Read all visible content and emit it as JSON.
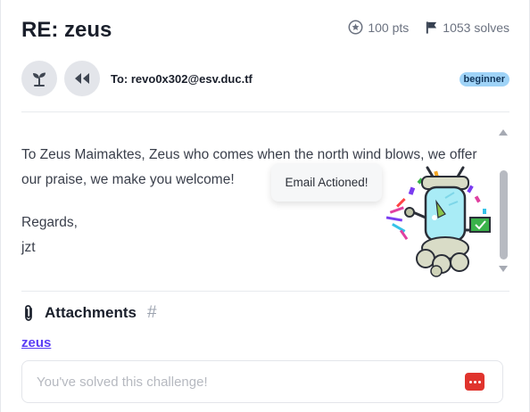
{
  "challenge": {
    "title": "RE: zeus",
    "points": "100 pts",
    "solves": "1053 solves",
    "to_line": "To: revo0x302@esv.duc.tf",
    "difficulty": "beginner"
  },
  "message": {
    "paragraph": "To Zeus Maimaktes, Zeus who comes when the north wind blows, we offer our praise, we make you welcome!",
    "signoff": "Regards,",
    "signature": "jzt"
  },
  "toast": {
    "text": "Email Actioned!"
  },
  "attachments": {
    "heading": "Attachments",
    "hash": "#",
    "files": [
      "zeus"
    ]
  },
  "flag_input": {
    "placeholder": "You've solved this challenge!",
    "value": ""
  },
  "icons": {
    "points": "star-circle-icon",
    "solves": "flag-icon",
    "plant": "sprout-icon",
    "rewind": "rewind-icon",
    "attach": "paperclip-icon",
    "password_manager": "password-manager-icon"
  },
  "colors": {
    "badge_bg": "#9fd3f7",
    "link": "#5b3df5",
    "button_bg": "#e3e5ea",
    "pw_icon": "#e0342d"
  }
}
